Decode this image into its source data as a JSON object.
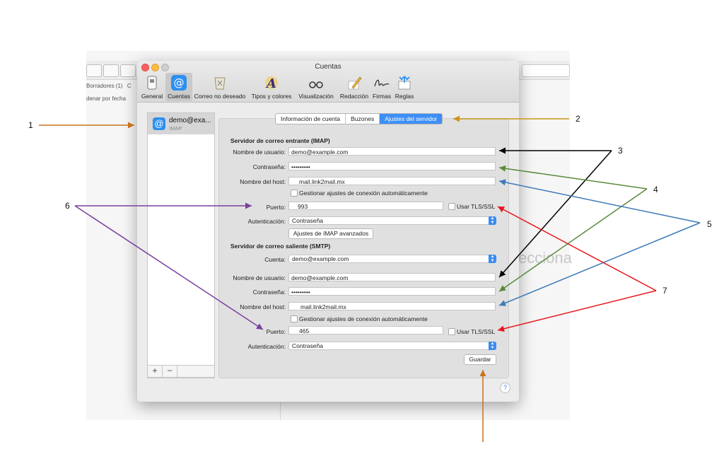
{
  "background": {
    "mailbox_drafts": "Borradores (1)",
    "mailbox_drafts_tail": "C",
    "sort_label": "denar por fecha",
    "watermark": "ecciona"
  },
  "window": {
    "title": "Cuentas",
    "toolbar": [
      {
        "label": "General",
        "icon": "general-icon"
      },
      {
        "label": "Cuentas",
        "icon": "at-icon",
        "active": true
      },
      {
        "label": "Correo no deseado",
        "icon": "junk-icon"
      },
      {
        "label": "Tipos y colores",
        "icon": "fonts-icon"
      },
      {
        "label": "Visualización",
        "icon": "glasses-icon"
      },
      {
        "label": "Redacción",
        "icon": "pencil-icon"
      },
      {
        "label": "Firmas",
        "icon": "signature-icon"
      },
      {
        "label": "Reglas",
        "icon": "rules-icon"
      }
    ]
  },
  "sidebar": {
    "account_name": "demo@exa...",
    "account_type": "IMAP",
    "add": "+",
    "remove": "−"
  },
  "tabs": [
    "Información de cuenta",
    "Buzones",
    "Ajustes del servidor"
  ],
  "active_tab": "Ajustes del servidor",
  "imap": {
    "heading": "Servidor de correo entrante (IMAP)",
    "username_label": "Nombre de usuario:",
    "username": "demo@example.com",
    "password_label": "Contraseña:",
    "password": "•••••••••",
    "host_label": "Nombre del host:",
    "host": "mail.link2mail.mx",
    "auto_manage": "Gestionar ajustes de conexión automáticamente",
    "port_label": "Puerto:",
    "port": "993",
    "tls_label": "Usar TLS/SSL",
    "auth_label": "Autenticación:",
    "auth": "Contraseña",
    "advanced_button": "Ajustes de IMAP avanzados"
  },
  "smtp": {
    "heading": "Servidor de correo saliente (SMTP)",
    "account_label": "Cuenta:",
    "account": "demo@example.com",
    "username_label": "Nombre de usuario:",
    "username": "demo@example.com",
    "password_label": "Contraseña:",
    "password": "•••••••••",
    "host_label": "Nombre del host:",
    "host": "mail.link2mail.mx",
    "auto_manage": "Gestionar ajustes de conexión automáticamente",
    "port_label": "Puerto:",
    "port": "465",
    "tls_label": "Usar TLS/SSL",
    "auth_label": "Autenticación:",
    "auth": "Contraseña"
  },
  "save_button": "Guardar",
  "help": "?",
  "callouts": [
    "1",
    "2",
    "3",
    "4",
    "5",
    "6",
    "7"
  ],
  "colors": {
    "accent": "#3d8ff6",
    "arrow_orange": "#c8711e",
    "arrow_gold": "#c9951a",
    "arrow_black": "#000000",
    "arrow_green": "#5b8a3a",
    "arrow_blue": "#3d7ab8",
    "arrow_purple": "#7a3fa0",
    "arrow_red": "#e8151b"
  }
}
